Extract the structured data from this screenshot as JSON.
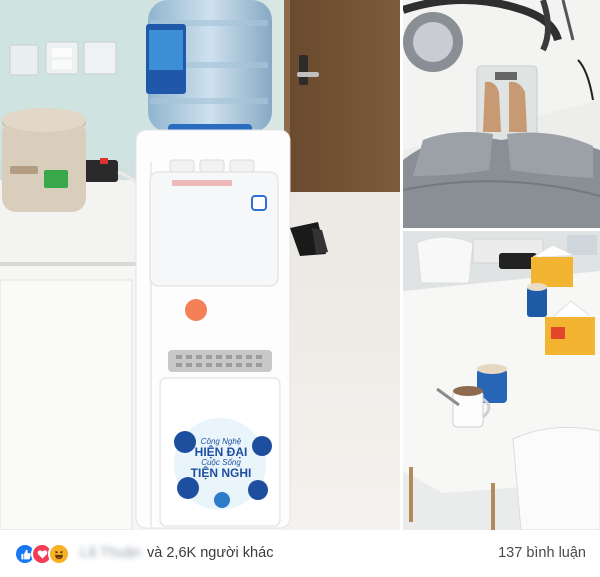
{
  "post": {
    "photos": [
      {
        "name": "water-dispenser-photo"
      },
      {
        "name": "scale-photo"
      },
      {
        "name": "dining-table-photo"
      }
    ],
    "dispenser_poster": {
      "line1": "Công Nghệ",
      "line2": "HIỆN ĐẠI",
      "line3": "Cuộc Sống",
      "line4": "TIỆN NGHI"
    },
    "footer": {
      "reactions": [
        "like-icon",
        "love-icon",
        "haha-icon"
      ],
      "reactor_name": "Lã Thuận",
      "others_text": "và 2,6K người khác",
      "comments_text": "137 bình luận"
    }
  },
  "colors": {
    "like": "#1877f2",
    "love": "#f33e58",
    "haha": "#f7b125"
  }
}
